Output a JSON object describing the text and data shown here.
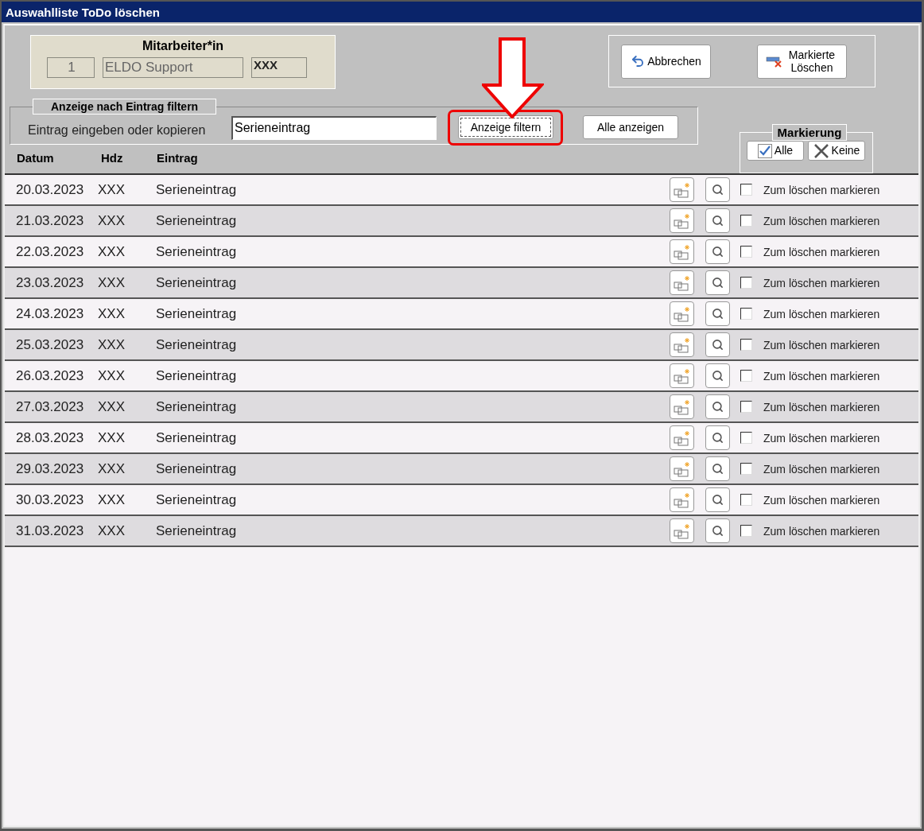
{
  "window": {
    "title": "Auswahlliste ToDo löschen"
  },
  "employee": {
    "title": "Mitarbeiter*in",
    "number": "1",
    "name": "ELDO Support",
    "code": "XXX"
  },
  "actions": [
    {
      "kind": "cancel",
      "label": "Abbrechen"
    },
    {
      "kind": "delete",
      "label": "Markierte Löschen"
    }
  ],
  "filter": {
    "legend": "Anzeige nach Eintrag filtern",
    "label": "Eintrag eingeben oder kopieren",
    "value": "Serieneintrag",
    "buttons": [
      {
        "label": "Anzeige filtern",
        "focused": true
      },
      {
        "label": "Alle anzeigen",
        "focused": false
      }
    ]
  },
  "columns": [
    "Datum",
    "Hdz",
    "Eintrag"
  ],
  "marking": {
    "title": "Markierung",
    "buttons": [
      {
        "kind": "all",
        "label": "Alle"
      },
      {
        "kind": "none",
        "label": "Keine"
      }
    ]
  },
  "rows": [
    {
      "date": "20.03.2023",
      "hdz": "XXX",
      "entry": "Serieneintrag",
      "mark_label": "Zum löschen markieren",
      "checked": false
    },
    {
      "date": "21.03.2023",
      "hdz": "XXX",
      "entry": "Serieneintrag",
      "mark_label": "Zum löschen markieren",
      "checked": false
    },
    {
      "date": "22.03.2023",
      "hdz": "XXX",
      "entry": "Serieneintrag",
      "mark_label": "Zum löschen markieren",
      "checked": false
    },
    {
      "date": "23.03.2023",
      "hdz": "XXX",
      "entry": "Serieneintrag",
      "mark_label": "Zum löschen markieren",
      "checked": false
    },
    {
      "date": "24.03.2023",
      "hdz": "XXX",
      "entry": "Serieneintrag",
      "mark_label": "Zum löschen markieren",
      "checked": false
    },
    {
      "date": "25.03.2023",
      "hdz": "XXX",
      "entry": "Serieneintrag",
      "mark_label": "Zum löschen markieren",
      "checked": false
    },
    {
      "date": "26.03.2023",
      "hdz": "XXX",
      "entry": "Serieneintrag",
      "mark_label": "Zum löschen markieren",
      "checked": false
    },
    {
      "date": "27.03.2023",
      "hdz": "XXX",
      "entry": "Serieneintrag",
      "mark_label": "Zum löschen markieren",
      "checked": false
    },
    {
      "date": "28.03.2023",
      "hdz": "XXX",
      "entry": "Serieneintrag",
      "mark_label": "Zum löschen markieren",
      "checked": false
    },
    {
      "date": "29.03.2023",
      "hdz": "XXX",
      "entry": "Serieneintrag",
      "mark_label": "Zum löschen markieren",
      "checked": false
    },
    {
      "date": "30.03.2023",
      "hdz": "XXX",
      "entry": "Serieneintrag",
      "mark_label": "Zum löschen markieren",
      "checked": false
    },
    {
      "date": "31.03.2023",
      "hdz": "XXX",
      "entry": "Serieneintrag",
      "mark_label": "Zum löschen markieren",
      "checked": false
    }
  ]
}
